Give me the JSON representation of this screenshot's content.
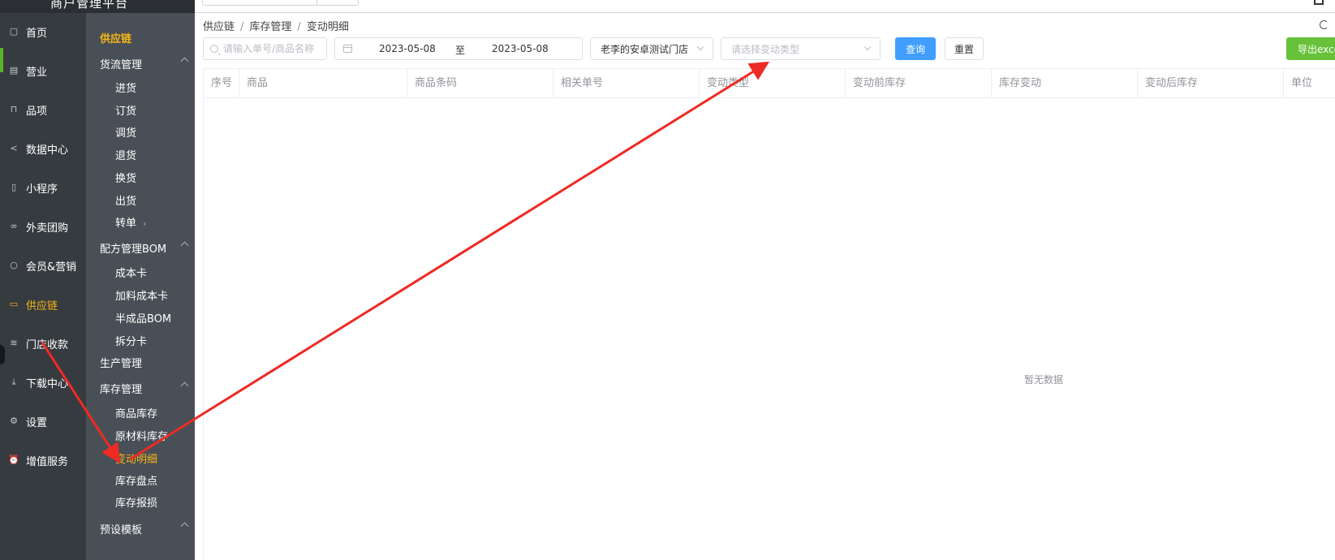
{
  "top": {
    "brand": "商户管理平台"
  },
  "nav1": {
    "items": [
      {
        "label": "首页",
        "icon": "home-icon"
      },
      {
        "label": "营业",
        "icon": "calendar-icon"
      },
      {
        "label": "品项",
        "icon": "bag-icon"
      },
      {
        "label": "数据中心",
        "icon": "share-icon"
      },
      {
        "label": "小程序",
        "icon": "phone-icon"
      },
      {
        "label": "外卖团购",
        "icon": "bike-icon"
      },
      {
        "label": "会员&营销",
        "icon": "user-icon"
      },
      {
        "label": "供应链",
        "icon": "truck-icon",
        "active": true
      },
      {
        "label": "门店收款",
        "icon": "database-icon"
      },
      {
        "label": "下载中心",
        "icon": "download-icon"
      },
      {
        "label": "设置",
        "icon": "gear-icon"
      },
      {
        "label": "增值服务",
        "icon": "alarm-icon"
      }
    ]
  },
  "nav2": {
    "title": "供应链",
    "groups": {
      "flow": "货流管理",
      "bom": "配方管理BOM",
      "production": "生产管理",
      "inventory": "库存管理",
      "preset": "预设模板"
    },
    "flow_items": [
      "进货",
      "订货",
      "调货",
      "退货",
      "换货",
      "出货",
      "转单"
    ],
    "bom_items": [
      "成本卡",
      "加料成本卡",
      "半成品BOM",
      "拆分卡"
    ],
    "inventory_items": [
      "商品库存",
      "原材料库存",
      "变动明细",
      "库存盘点",
      "库存报损"
    ]
  },
  "breadcrumb": [
    "供应链",
    "库存管理",
    "变动明细"
  ],
  "filters": {
    "search_placeholder": "请输入单号/商品名称",
    "date_start": "2023-05-08",
    "date_sep": "至",
    "date_end": "2023-05-08",
    "store": "老李的安卓测试门店",
    "type_placeholder": "请选择变动类型"
  },
  "buttons": {
    "query": "查询",
    "reset": "重置",
    "export": "导出excel"
  },
  "table": {
    "columns": [
      "序号",
      "商品",
      "商品条码",
      "相关单号",
      "变动类型",
      "变动前库存",
      "库存变动",
      "变动后库存",
      "单位"
    ],
    "empty_text": "暂无数据"
  },
  "colors": {
    "accent": "#f7b718",
    "primary": "#409eff",
    "success": "#67c23a",
    "annotation": "#ee2a24"
  }
}
